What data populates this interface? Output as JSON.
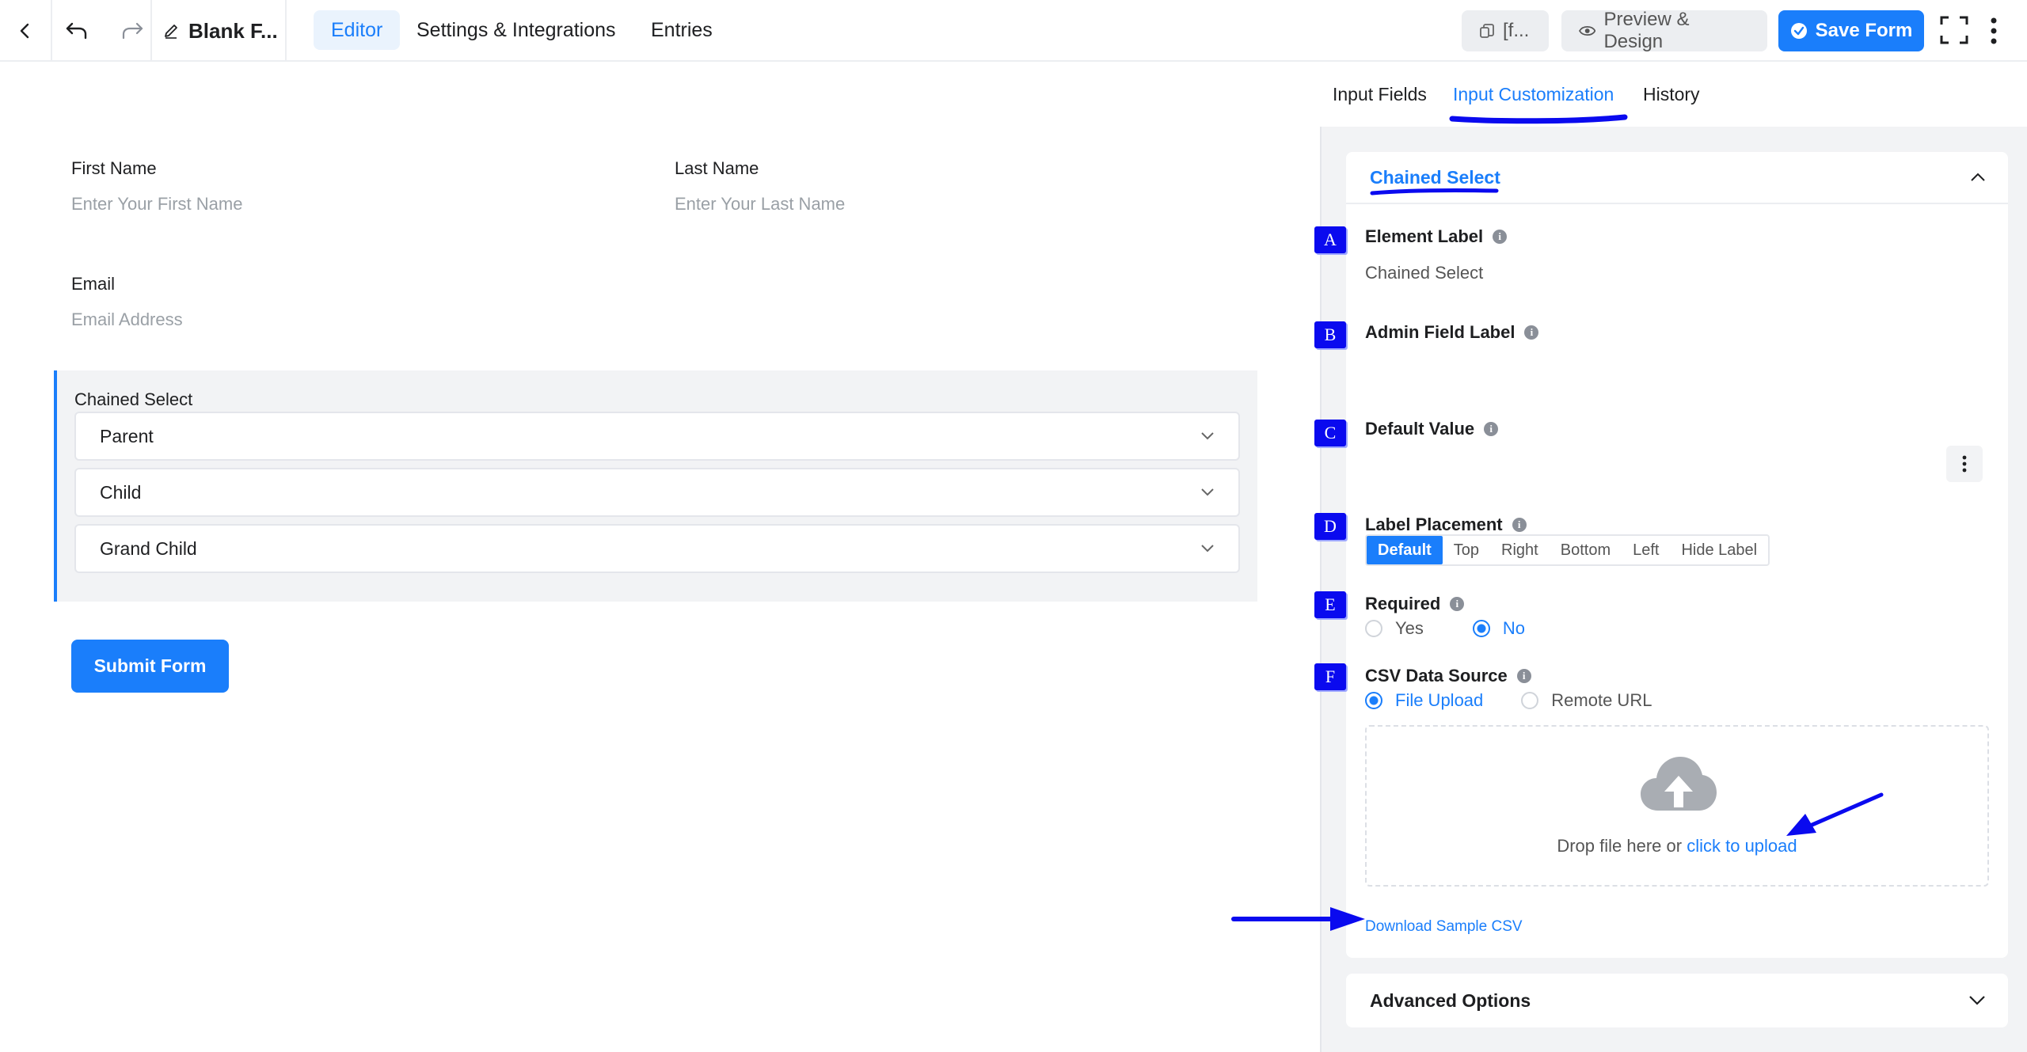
{
  "topbar": {
    "title": "Blank F...",
    "tabs": [
      "Editor",
      "Settings & Integrations",
      "Entries"
    ],
    "shortcode_label": "[f...",
    "preview_label": "Preview & Design",
    "save_label": "Save Form"
  },
  "form": {
    "first_name_label": "First Name",
    "first_name_placeholder": "Enter Your First Name",
    "last_name_label": "Last Name",
    "last_name_placeholder": "Enter Your Last Name",
    "email_label": "Email",
    "email_placeholder": "Email Address",
    "chained_label": "Chained Select",
    "selects": [
      "Parent",
      "Child",
      "Grand Child"
    ],
    "submit_label": "Submit Form"
  },
  "panel": {
    "tabs": [
      "Input Fields",
      "Input Customization",
      "History"
    ],
    "active_tab": "Input Customization",
    "section_title": "Chained Select",
    "markers": [
      "A",
      "B",
      "C",
      "D",
      "E",
      "F"
    ],
    "element_label": {
      "label": "Element Label",
      "value": "Chained Select"
    },
    "admin_field_label": {
      "label": "Admin Field Label",
      "value": ""
    },
    "default_value": {
      "label": "Default Value",
      "value": ""
    },
    "label_placement": {
      "label": "Label Placement",
      "options": [
        "Default",
        "Top",
        "Right",
        "Bottom",
        "Left",
        "Hide Label"
      ],
      "selected": "Default"
    },
    "required": {
      "label": "Required",
      "options": [
        "Yes",
        "No"
      ],
      "selected": "No"
    },
    "csv_source": {
      "label": "CSV Data Source",
      "options": [
        "File Upload",
        "Remote URL"
      ],
      "selected": "File Upload"
    },
    "upload_text": "Drop file here or",
    "upload_link": "click to upload",
    "download_link": "Download Sample CSV",
    "advanced_label": "Advanced Options"
  },
  "colors": {
    "accent": "#1a7efb",
    "annotation": "#0a0aef",
    "panel_bg": "#f2f3f5"
  },
  "icons": [
    "back-icon",
    "undo-icon",
    "redo-icon",
    "edit-icon",
    "copy-icon",
    "eye-icon",
    "check-circle-icon",
    "fullscreen-icon",
    "kebab-icon",
    "chevron-down-icon",
    "chevron-up-icon",
    "info-icon",
    "cloud-upload-icon"
  ]
}
